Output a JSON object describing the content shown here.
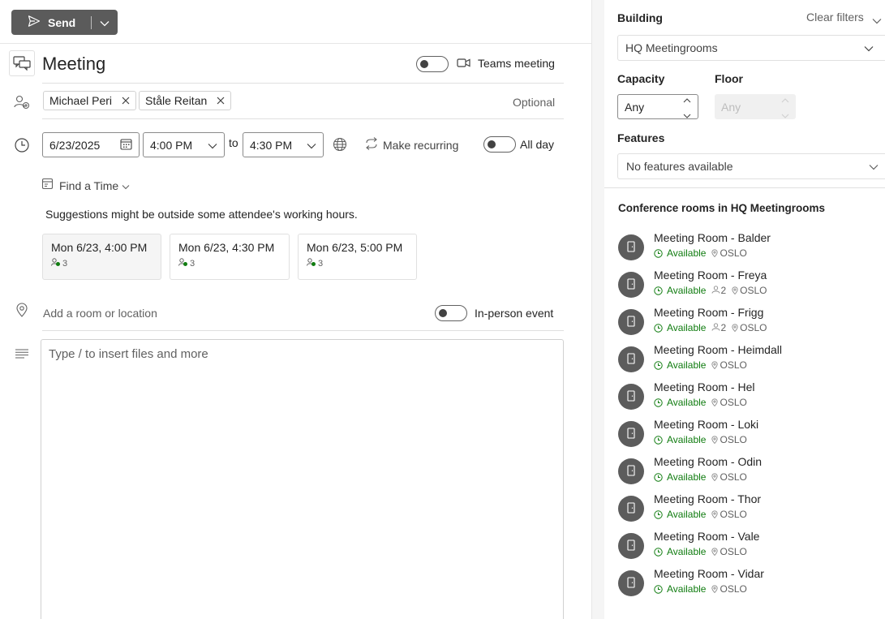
{
  "toolbar": {
    "send_label": "Send"
  },
  "event": {
    "title": "Meeting",
    "teams_label": "Teams meeting",
    "attendees": [
      "Michael Peri",
      "Ståle Reitan"
    ],
    "optional_label": "Optional",
    "date": "6/23/2025",
    "start_time": "4:00 PM",
    "to_label": "to",
    "end_time": "4:30 PM",
    "recurring_label": "Make recurring",
    "all_day_label": "All day",
    "find_time_label": "Find a Time",
    "suggestion_note": "Suggestions might be outside some attendee's working hours.",
    "suggestions": [
      {
        "time": "Mon 6/23, 4:00 PM",
        "count": "3"
      },
      {
        "time": "Mon 6/23, 4:30 PM",
        "count": "3"
      },
      {
        "time": "Mon 6/23, 5:00 PM",
        "count": "3"
      }
    ],
    "location_placeholder": "Add a room or location",
    "in_person_label": "In-person event",
    "body_placeholder": "Type / to insert files and more"
  },
  "filters": {
    "building_label": "Building",
    "clear_label": "Clear filters",
    "building_value": "HQ Meetingrooms",
    "capacity_label": "Capacity",
    "capacity_value": "Any",
    "floor_label": "Floor",
    "floor_value": "Any",
    "features_label": "Features",
    "features_value": "No features available"
  },
  "rooms_header": "Conference rooms in HQ Meetingrooms",
  "rooms": [
    {
      "name": "Meeting Room - Balder",
      "status": "Available",
      "capacity": "",
      "location": "OSLO"
    },
    {
      "name": "Meeting Room - Freya",
      "status": "Available",
      "capacity": "2",
      "location": "OSLO"
    },
    {
      "name": "Meeting Room - Frigg",
      "status": "Available",
      "capacity": "2",
      "location": "OSLO"
    },
    {
      "name": "Meeting Room - Heimdall",
      "status": "Available",
      "capacity": "",
      "location": "OSLO"
    },
    {
      "name": "Meeting Room - Hel",
      "status": "Available",
      "capacity": "",
      "location": "OSLO"
    },
    {
      "name": "Meeting Room - Loki",
      "status": "Available",
      "capacity": "",
      "location": "OSLO"
    },
    {
      "name": "Meeting Room - Odin",
      "status": "Available",
      "capacity": "",
      "location": "OSLO"
    },
    {
      "name": "Meeting Room - Thor",
      "status": "Available",
      "capacity": "",
      "location": "OSLO"
    },
    {
      "name": "Meeting Room - Vale",
      "status": "Available",
      "capacity": "",
      "location": "OSLO"
    },
    {
      "name": "Meeting Room - Vidar",
      "status": "Available",
      "capacity": "",
      "location": "OSLO"
    }
  ],
  "colors": {
    "accent": "#5b5b5b",
    "available": "#107c10",
    "avatar": "#5c5c5c"
  }
}
